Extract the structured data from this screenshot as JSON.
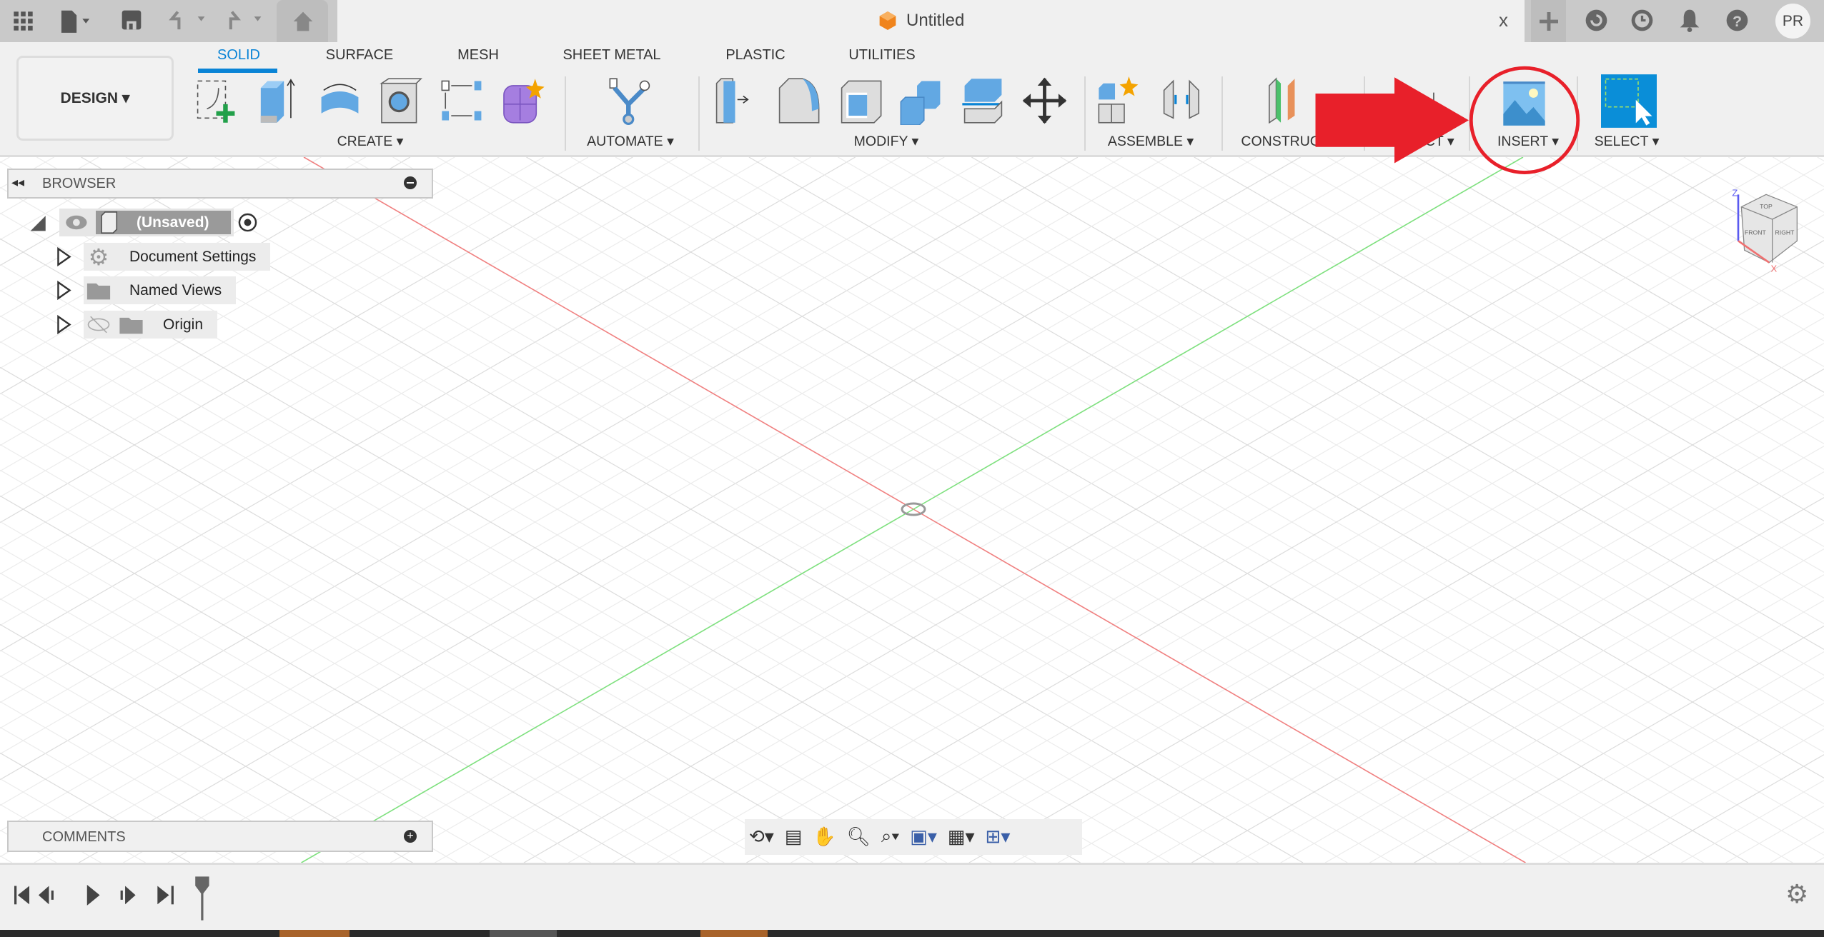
{
  "window": {
    "title": "Untitled",
    "close_label": "x",
    "avatar_initials": "PR"
  },
  "toolbar": {
    "workspace_label": "DESIGN ▾",
    "tabs": [
      {
        "label": "SOLID"
      },
      {
        "label": "SURFACE"
      },
      {
        "label": "MESH"
      },
      {
        "label": "SHEET METAL"
      },
      {
        "label": "PLASTIC"
      },
      {
        "label": "UTILITIES"
      }
    ],
    "groups": [
      {
        "label": "CREATE ▾"
      },
      {
        "label": "AUTOMATE ▾"
      },
      {
        "label": "MODIFY ▾"
      },
      {
        "label": "ASSEMBLE ▾"
      },
      {
        "label": "CONSTRUCT ▾"
      },
      {
        "label": "INSPECT ▾"
      },
      {
        "label": "INSERT ▾"
      },
      {
        "label": "SELECT ▾"
      }
    ]
  },
  "browser": {
    "title": "BROWSER",
    "root": "(Unsaved)",
    "items": [
      {
        "label": "Document Settings"
      },
      {
        "label": "Named Views"
      },
      {
        "label": "Origin"
      }
    ]
  },
  "comments": {
    "title": "COMMENTS"
  },
  "viewcube": {
    "top": "TOP",
    "front": "FRONT",
    "right": "RIGHT",
    "z": "Z",
    "x": "X"
  },
  "colors": {
    "accent": "#0a84d6",
    "annotation": "#e8202a",
    "x_axis": "#f08080",
    "y_axis": "#7ee07e"
  }
}
